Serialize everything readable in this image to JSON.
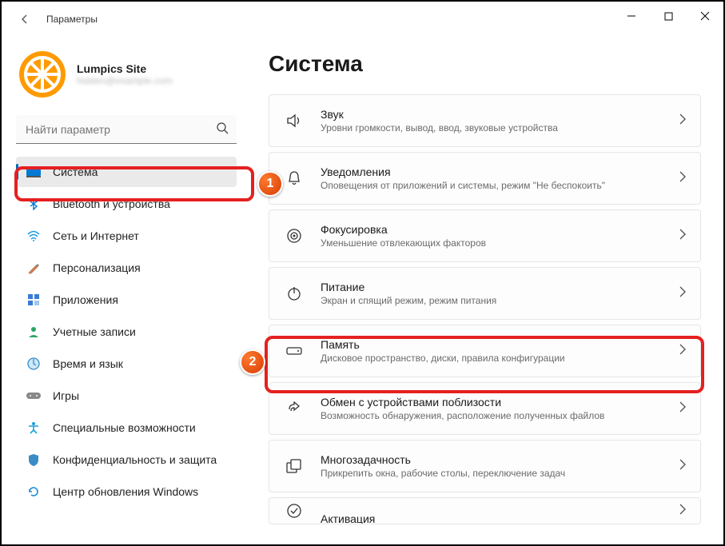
{
  "window": {
    "title": "Параметры"
  },
  "user": {
    "name": "Lumpics Site",
    "email": "hidden@example.com"
  },
  "search": {
    "placeholder": "Найти параметр"
  },
  "sidebar": {
    "items": [
      {
        "label": "Система"
      },
      {
        "label": "Bluetooth и устройства"
      },
      {
        "label": "Сеть и Интернет"
      },
      {
        "label": "Персонализация"
      },
      {
        "label": "Приложения"
      },
      {
        "label": "Учетные записи"
      },
      {
        "label": "Время и язык"
      },
      {
        "label": "Игры"
      },
      {
        "label": "Специальные возможности"
      },
      {
        "label": "Конфиденциальность и защита"
      },
      {
        "label": "Центр обновления Windows"
      }
    ]
  },
  "main": {
    "heading": "Система",
    "rows": [
      {
        "title": "Звук",
        "sub": "Уровни громкости, вывод, ввод, звуковые устройства"
      },
      {
        "title": "Уведомления",
        "sub": "Оповещения от приложений и системы, режим \"Не беспокоить\""
      },
      {
        "title": "Фокусировка",
        "sub": "Уменьшение отвлекающих факторов"
      },
      {
        "title": "Питание",
        "sub": "Экран и спящий режим, режим питания"
      },
      {
        "title": "Память",
        "sub": "Дисковое пространство, диски, правила конфигурации"
      },
      {
        "title": "Обмен с устройствами поблизости",
        "sub": "Возможность обнаружения, расположение полученных файлов"
      },
      {
        "title": "Многозадачность",
        "sub": "Прикрепить окна, рабочие столы, переключение задач"
      },
      {
        "title": "Активация",
        "sub": ""
      }
    ]
  },
  "badges": {
    "one": "1",
    "two": "2"
  }
}
